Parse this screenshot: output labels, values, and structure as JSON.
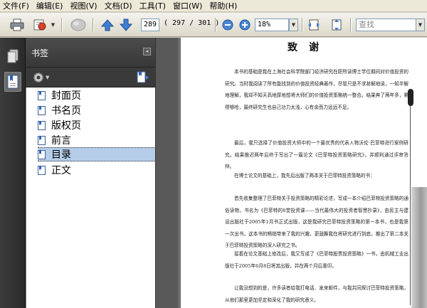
{
  "menubar": {
    "items": [
      "文件(F)",
      "编辑(E)",
      "视图(V)",
      "文档(D)",
      "工具(T)",
      "窗口(W)",
      "帮助(H)"
    ]
  },
  "toolbar": {
    "current_page": "289",
    "page_info": "( 297 / 301 )",
    "zoom": "18%",
    "search_placeholder": "查找",
    "icons": [
      "print-icon",
      "email-icon",
      "collaborate-icon",
      "previous-page-icon",
      "next-page-icon",
      "zoom-out-icon",
      "zoom-in-icon",
      "fit-width-icon",
      "fit-page-icon"
    ]
  },
  "panel": {
    "title": "书签",
    "bookmarks": [
      {
        "label": "封面页",
        "selected": false
      },
      {
        "label": "书名页",
        "selected": false
      },
      {
        "label": "版权页",
        "selected": false
      },
      {
        "label": "前言",
        "selected": false
      },
      {
        "label": "目录",
        "selected": true
      },
      {
        "label": "正文",
        "selected": false
      }
    ]
  },
  "document": {
    "title": "致谢",
    "paragraphs": [
      "本书的基础是我在上海社会科学院部门经济研究在职所读博士学位期间对价值投资的研究。当时我阅读了所有能找到的价值投资经典著作，尽管只是不求甚解地读，一知半解地理解，我却不知天高地厚地想将大师们的价值投资策略统一整合。结果奔了两年多，累得够呛，最终研究生也自己功力太浅，心有余而力远远不足。",
      "最后，我只选择了价值投资大师中的一个最优秀的代表人物沃伦·巴菲特进行案例研究。结果推迟两年后终于写出了一篇论文《巴菲特投资策略研究》，并顺利通过评审答辩。",
      "在博士论文的基础上，我先后出版了两本关于巴菲特投资策略的书：",
      "首先收集整理了巴菲特关于投资策略的精彩论述，写成一本介绍巴菲特投资策略的通俗读物，书名为《巴菲特的8堂投资课——当代最伟大的投资者智慧抄录》，由民主与建设出版社于2005年1月书正式出版，这是我研究巴菲特投资策略的第一本书，也是我第一次出书。这本书的畅销带来了我的兴趣，更鼓舞我在将研究进行到底，推出了第二本关于巴菲特投资策略的深入研究之书。",
      "接着在论文基础上修改后，我又写成了《巴菲特股票投资策略》一书，由机械工业出版社于2005年6月8日将其出版，并在两个月后重印。",
      "让我没想到的是，许多读者给我打电话、发来邮件，与我共同探讨巴菲特投资策略，从他们那里更加坚定和深化了我的研究意义。"
    ]
  }
}
